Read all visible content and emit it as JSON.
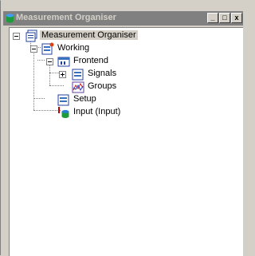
{
  "window": {
    "title": "Measurement Organiser",
    "buttons": {
      "minimize": "_",
      "maximize": "□",
      "close": "x"
    }
  },
  "tree": {
    "root": {
      "label": "Measurement Organiser",
      "icon": "organiser-icon",
      "selected": true,
      "expanded": true
    },
    "working": {
      "label": "Working",
      "icon": "config-icon",
      "expanded": true
    },
    "frontend": {
      "label": "Frontend",
      "icon": "frontend-icon",
      "expanded": true
    },
    "signals": {
      "label": "Signals",
      "icon": "signals-icon",
      "expanded": false
    },
    "groups": {
      "label": "Groups",
      "icon": "groups-icon"
    },
    "setup": {
      "label": "Setup",
      "icon": "setup-icon"
    },
    "input": {
      "label": "Input (Input)",
      "icon": "input-icon"
    }
  }
}
